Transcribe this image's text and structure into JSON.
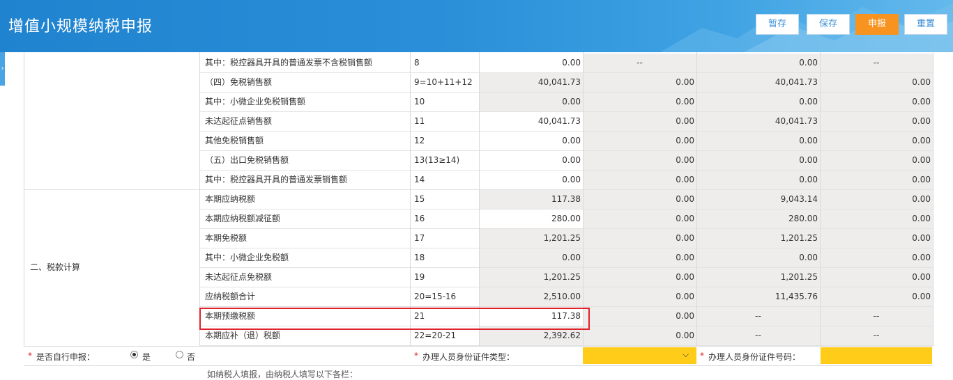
{
  "header": {
    "title": "增值小规模纳税申报"
  },
  "toolbar": {
    "save_temp": "暂存",
    "save": "保存",
    "declare": "申报",
    "reset": "重置"
  },
  "sections": {
    "tax_calc": "二、税款计算"
  },
  "rows": [
    {
      "label": "其中：税控器具开具的普通发票不含税销售额",
      "code": "8",
      "c1": "0.00",
      "c2": "--",
      "c3": "0.00",
      "c4": "--"
    },
    {
      "label": "（四）免税销售额",
      "code": "9=10+11+12",
      "c1": "40,041.73",
      "c2": "0.00",
      "c3": "40,041.73",
      "c4": "0.00"
    },
    {
      "label": "其中：小微企业免税销售额",
      "code": "10",
      "c1": "0.00",
      "c2": "0.00",
      "c3": "0.00",
      "c4": "0.00"
    },
    {
      "label": "未达起征点销售额",
      "code": "11",
      "c1": "40,041.73",
      "c2": "0.00",
      "c3": "40,041.73",
      "c4": "0.00"
    },
    {
      "label": "其他免税销售额",
      "code": "12",
      "c1": "0.00",
      "c2": "0.00",
      "c3": "0.00",
      "c4": "0.00"
    },
    {
      "label": "（五）出口免税销售额",
      "code": "13(13≥14)",
      "c1": "0.00",
      "c2": "0.00",
      "c3": "0.00",
      "c4": "0.00"
    },
    {
      "label": "其中：税控器具开具的普通发票销售额",
      "code": "14",
      "c1": "0.00",
      "c2": "0.00",
      "c3": "0.00",
      "c4": "0.00"
    },
    {
      "label": "本期应纳税额",
      "code": "15",
      "c1": "117.38",
      "c2": "0.00",
      "c3": "9,043.14",
      "c4": "0.00"
    },
    {
      "label": "本期应纳税额减征额",
      "code": "16",
      "c1": "280.00",
      "c2": "0.00",
      "c3": "280.00",
      "c4": "0.00"
    },
    {
      "label": "本期免税额",
      "code": "17",
      "c1": "1,201.25",
      "c2": "0.00",
      "c3": "1,201.25",
      "c4": "0.00"
    },
    {
      "label": "其中：小微企业免税额",
      "code": "18",
      "c1": "0.00",
      "c2": "0.00",
      "c3": "0.00",
      "c4": "0.00"
    },
    {
      "label": "未达起征点免税额",
      "code": "19",
      "c1": "1,201.25",
      "c2": "0.00",
      "c3": "1,201.25",
      "c4": "0.00"
    },
    {
      "label": "应纳税额合计",
      "code": "20=15-16",
      "c1": "2,510.00",
      "c2": "0.00",
      "c3": "11,435.76",
      "c4": "0.00"
    },
    {
      "label": "本期预缴税额",
      "code": "21",
      "c1": "117.38",
      "c2": "0.00",
      "c3": "--",
      "c4": "--"
    },
    {
      "label": "本期应补（退）税额",
      "code": "22=20-21",
      "c1": "2,392.62",
      "c2": "0.00",
      "c3": "--",
      "c4": "--"
    }
  ],
  "footer": {
    "self_declare_label": "是否自行申报：",
    "yes": "是",
    "no": "否",
    "id_type_label": "办理人员身份证件类型：",
    "id_no_label": "办理人员身份证件号码：",
    "star": "*",
    "note": "如纳税人填报，由纳税人填写以下各栏："
  },
  "colors": {
    "header": "#1f83cf",
    "primary_button": "#f7931e",
    "highlight": "#e0232a",
    "required_field": "#ffcc1a"
  }
}
